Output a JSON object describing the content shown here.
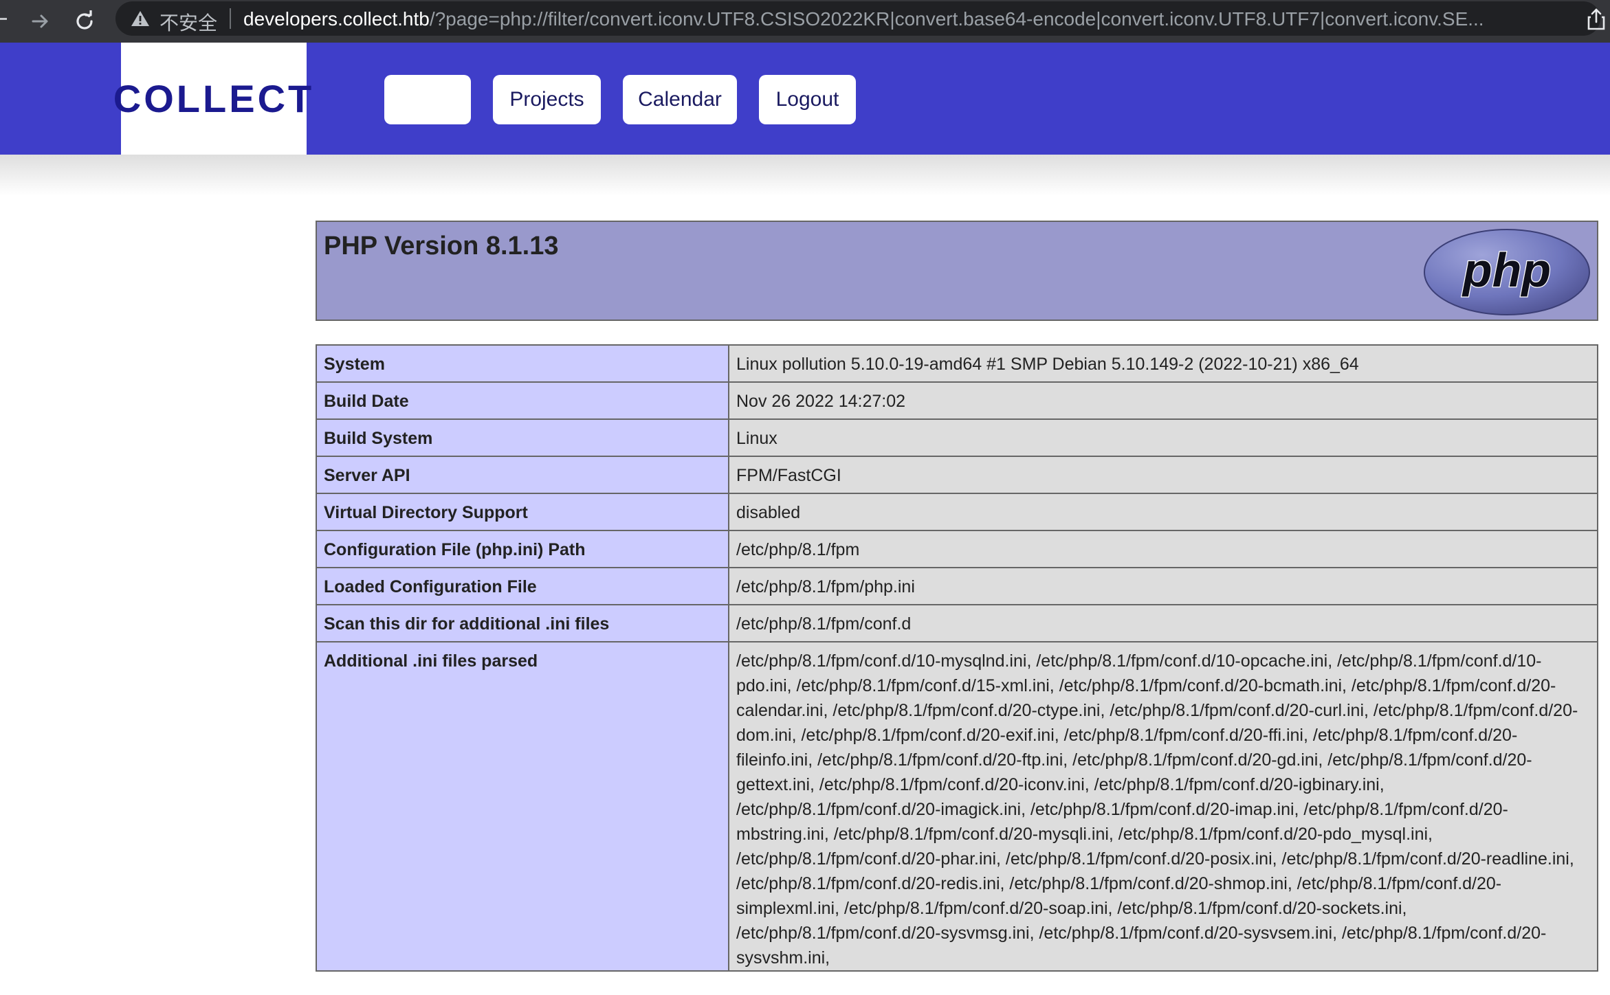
{
  "browser": {
    "insecure_label": "不安全",
    "url_host": "developers.collect.htb",
    "url_rest": "/?page=php://filter/convert.iconv.UTF8.CSISO2022KR|convert.base64-encode|convert.iconv.UTF8.UTF7|convert.iconv.SE..."
  },
  "site": {
    "logo": "COLLECT",
    "nav": {
      "blank": "",
      "projects": "Projects",
      "calendar": "Calendar",
      "logout": "Logout"
    },
    "brand_color": "#3f3ec9"
  },
  "phpinfo": {
    "title": "PHP Version 8.1.13",
    "logo_text": "php",
    "rows": [
      {
        "key": "System",
        "value": "Linux pollution 5.10.0-19-amd64 #1 SMP Debian 5.10.149-2 (2022-10-21) x86_64"
      },
      {
        "key": "Build Date",
        "value": "Nov 26 2022 14:27:02"
      },
      {
        "key": "Build System",
        "value": "Linux"
      },
      {
        "key": "Server API",
        "value": "FPM/FastCGI"
      },
      {
        "key": "Virtual Directory Support",
        "value": "disabled"
      },
      {
        "key": "Configuration File (php.ini) Path",
        "value": "/etc/php/8.1/fpm"
      },
      {
        "key": "Loaded Configuration File",
        "value": "/etc/php/8.1/fpm/php.ini"
      },
      {
        "key": "Scan this dir for additional .ini files",
        "value": "/etc/php/8.1/fpm/conf.d"
      },
      {
        "key": "Additional .ini files parsed",
        "value": "/etc/php/8.1/fpm/conf.d/10-mysqlnd.ini, /etc/php/8.1/fpm/conf.d/10-opcache.ini, /etc/php/8.1/fpm/conf.d/10-pdo.ini, /etc/php/8.1/fpm/conf.d/15-xml.ini, /etc/php/8.1/fpm/conf.d/20-bcmath.ini, /etc/php/8.1/fpm/conf.d/20-calendar.ini, /etc/php/8.1/fpm/conf.d/20-ctype.ini, /etc/php/8.1/fpm/conf.d/20-curl.ini, /etc/php/8.1/fpm/conf.d/20-dom.ini, /etc/php/8.1/fpm/conf.d/20-exif.ini, /etc/php/8.1/fpm/conf.d/20-ffi.ini, /etc/php/8.1/fpm/conf.d/20-fileinfo.ini, /etc/php/8.1/fpm/conf.d/20-ftp.ini, /etc/php/8.1/fpm/conf.d/20-gd.ini, /etc/php/8.1/fpm/conf.d/20-gettext.ini, /etc/php/8.1/fpm/conf.d/20-iconv.ini, /etc/php/8.1/fpm/conf.d/20-igbinary.ini, /etc/php/8.1/fpm/conf.d/20-imagick.ini, /etc/php/8.1/fpm/conf.d/20-imap.ini, /etc/php/8.1/fpm/conf.d/20-mbstring.ini, /etc/php/8.1/fpm/conf.d/20-mysqli.ini, /etc/php/8.1/fpm/conf.d/20-pdo_mysql.ini, /etc/php/8.1/fpm/conf.d/20-phar.ini, /etc/php/8.1/fpm/conf.d/20-posix.ini, /etc/php/8.1/fpm/conf.d/20-readline.ini, /etc/php/8.1/fpm/conf.d/20-redis.ini, /etc/php/8.1/fpm/conf.d/20-shmop.ini, /etc/php/8.1/fpm/conf.d/20-simplexml.ini, /etc/php/8.1/fpm/conf.d/20-soap.ini, /etc/php/8.1/fpm/conf.d/20-sockets.ini, /etc/php/8.1/fpm/conf.d/20-sysvmsg.ini, /etc/php/8.1/fpm/conf.d/20-sysvsem.ini, /etc/php/8.1/fpm/conf.d/20-sysvshm.ini,"
      }
    ]
  }
}
